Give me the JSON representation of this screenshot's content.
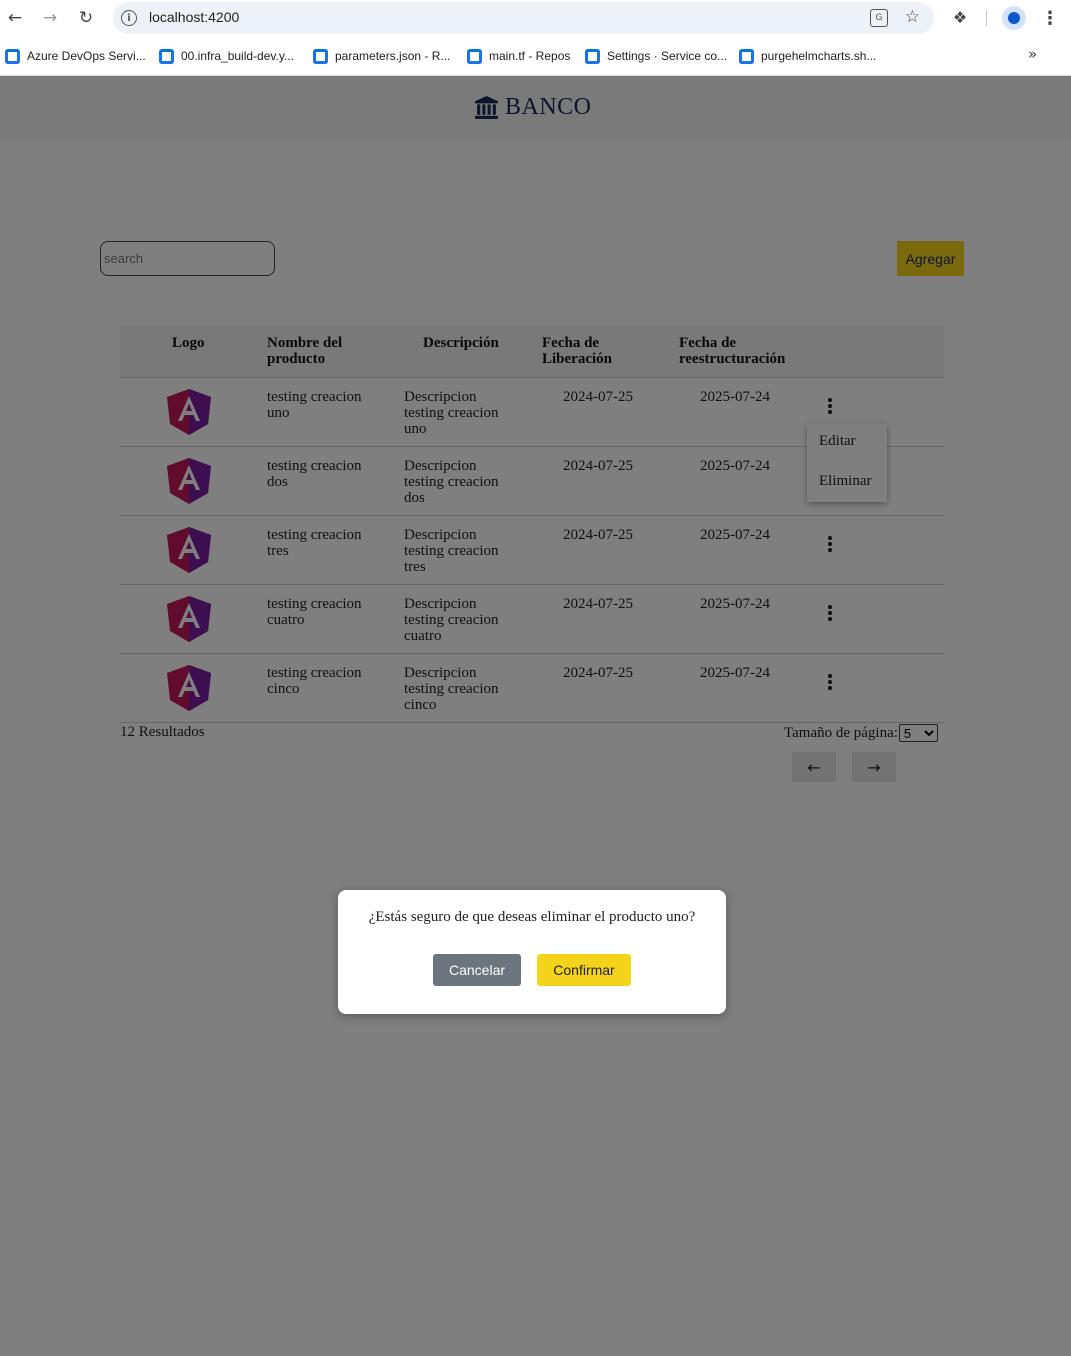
{
  "browser": {
    "url": "localhost:4200",
    "bookmarks": [
      "Azure DevOps Servi...",
      "00.infra_build-dev.y...",
      "parameters.json - R...",
      "main.tf - Repos",
      "Settings · Service co...",
      "purgehelmcharts.sh..."
    ],
    "more_bookmarks": "»"
  },
  "app": {
    "brand": "BANCO",
    "search": {
      "placeholder": "search",
      "value": ""
    },
    "add_button": "Agregar",
    "table": {
      "headers": [
        "Logo",
        "Nombre del producto",
        "Descripción",
        "Fecha de Liberación",
        "Fecha de reestructuración"
      ],
      "rows": [
        {
          "logo": "angular-logo",
          "name": "testing creacion uno",
          "description": "Descripcion testing creacion uno",
          "release_date": "2024-07-25",
          "restructure_date": "2025-07-24"
        },
        {
          "logo": "angular-logo",
          "name": "testing creacion dos",
          "description": "Descripcion testing creacion dos",
          "release_date": "2024-07-25",
          "restructure_date": "2025-07-24"
        },
        {
          "logo": "angular-logo",
          "name": "testing creacion tres",
          "description": "Descripcion testing creacion tres",
          "release_date": "2024-07-25",
          "restructure_date": "2025-07-24"
        },
        {
          "logo": "angular-logo",
          "name": "testing creacion cuatro",
          "description": "Descripcion testing creacion cuatro",
          "release_date": "2024-07-25",
          "restructure_date": "2025-07-24"
        },
        {
          "logo": "angular-logo",
          "name": "testing creacion cinco",
          "description": "Descripcion testing creacion cinco",
          "release_date": "2024-07-25",
          "restructure_date": "2025-07-24"
        }
      ]
    },
    "row_menu": {
      "edit": "Editar",
      "delete": "Eliminar"
    },
    "results": "12 Resultados",
    "page_size_label": "Tamaño de página:",
    "page_size_value": "5",
    "prev_icon": "←",
    "next_icon": "→"
  },
  "modal": {
    "message": "¿Estás seguro de que deseas eliminar el producto uno?",
    "cancel": "Cancelar",
    "confirm": "Confirmar"
  },
  "colors": {
    "accent": "#f4d41b",
    "brand": "#1b2a57",
    "cancel": "#6c757d",
    "overlay": "rgba(0,0,0,0.5)"
  }
}
